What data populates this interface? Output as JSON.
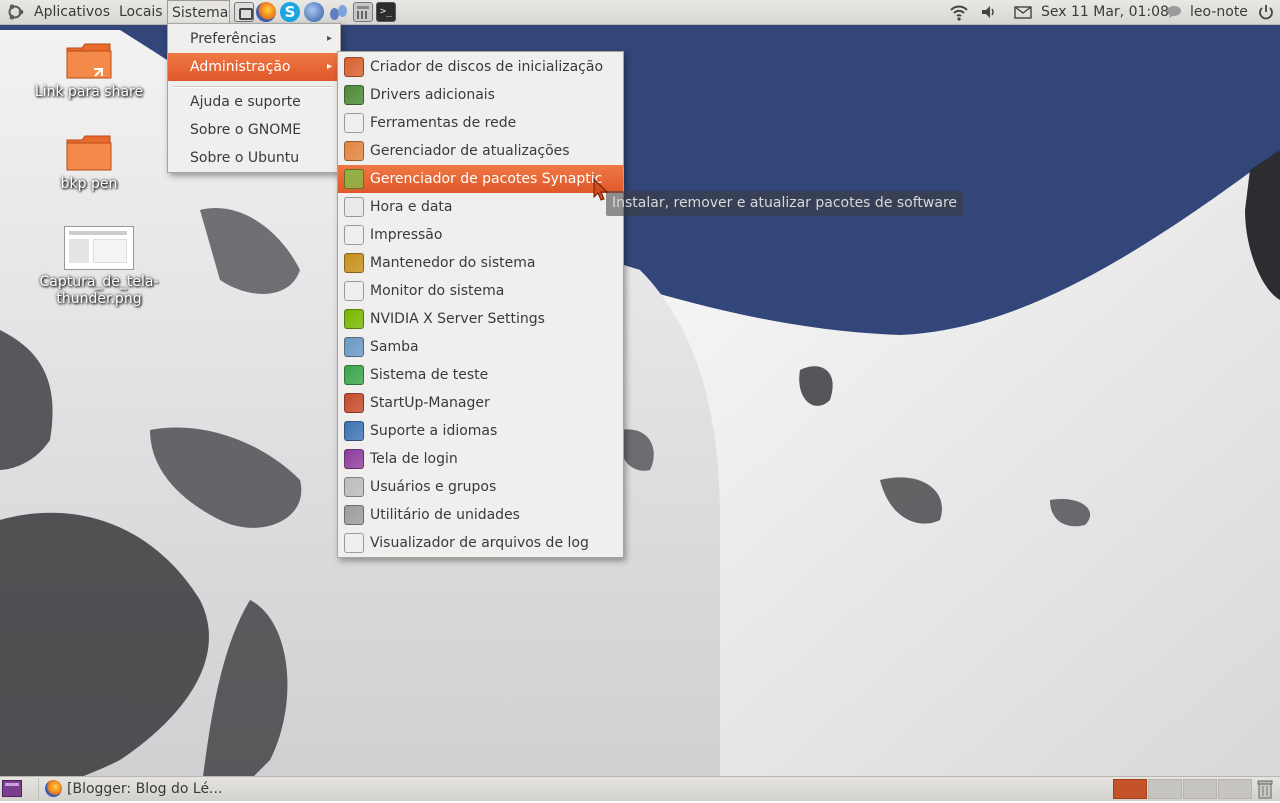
{
  "top_panel": {
    "menus": [
      "Aplicativos",
      "Locais",
      "Sistema"
    ],
    "clock": "Sex 11 Mar, 01:08",
    "user": "leo-note"
  },
  "sistema_menu": {
    "items": [
      {
        "label": "Preferências",
        "submenu": true
      },
      {
        "label": "Administração",
        "submenu": true,
        "highlighted": true
      },
      {
        "label": "Ajuda e suporte"
      },
      {
        "label": "Sobre o GNOME"
      },
      {
        "label": "Sobre o Ubuntu"
      }
    ]
  },
  "admin_menu": {
    "items": [
      {
        "label": "Criador de discos de inicialização",
        "icon": "startup-disk-icon"
      },
      {
        "label": "Drivers adicionais",
        "icon": "drivers-icon"
      },
      {
        "label": "Ferramentas de rede",
        "icon": "network-tools-icon"
      },
      {
        "label": "Gerenciador de atualizações",
        "icon": "update-manager-icon"
      },
      {
        "label": "Gerenciador de pacotes Synaptic",
        "icon": "synaptic-icon",
        "highlighted": true
      },
      {
        "label": "Hora e data",
        "icon": "calendar-clock-icon"
      },
      {
        "label": "Impressão",
        "icon": "printer-icon"
      },
      {
        "label": "Mantenedor do sistema",
        "icon": "broom-icon"
      },
      {
        "label": "Monitor do sistema",
        "icon": "system-monitor-icon"
      },
      {
        "label": "NVIDIA X Server Settings",
        "icon": "nvidia-icon"
      },
      {
        "label": "Samba",
        "icon": "samba-icon"
      },
      {
        "label": "Sistema de teste",
        "icon": "checkbox-icon"
      },
      {
        "label": "StartUp-Manager",
        "icon": "wrench-icon"
      },
      {
        "label": "Suporte a idiomas",
        "icon": "language-icon"
      },
      {
        "label": "Tela de login",
        "icon": "login-screen-icon"
      },
      {
        "label": "Usuários e grupos",
        "icon": "users-icon"
      },
      {
        "label": "Utilitário de unidades",
        "icon": "disk-utility-icon"
      },
      {
        "label": "Visualizador de arquivos de log",
        "icon": "log-viewer-icon"
      }
    ]
  },
  "tooltip": "Instalar, remover e atualizar pacotes de software",
  "desktop": {
    "icons": [
      {
        "label": "Link para share",
        "type": "folder-link"
      },
      {
        "label": "bkp pen",
        "type": "folder"
      },
      {
        "label": "Captura_de_tela-thunder.png",
        "type": "image"
      }
    ]
  },
  "bottom_panel": {
    "task": "[Blogger: Blog do Lé...",
    "workspaces": 4,
    "active_workspace": 1
  },
  "colors": {
    "accent": "#e2602f",
    "panel": "#dcdad5",
    "menu_bg": "#f0efed"
  }
}
